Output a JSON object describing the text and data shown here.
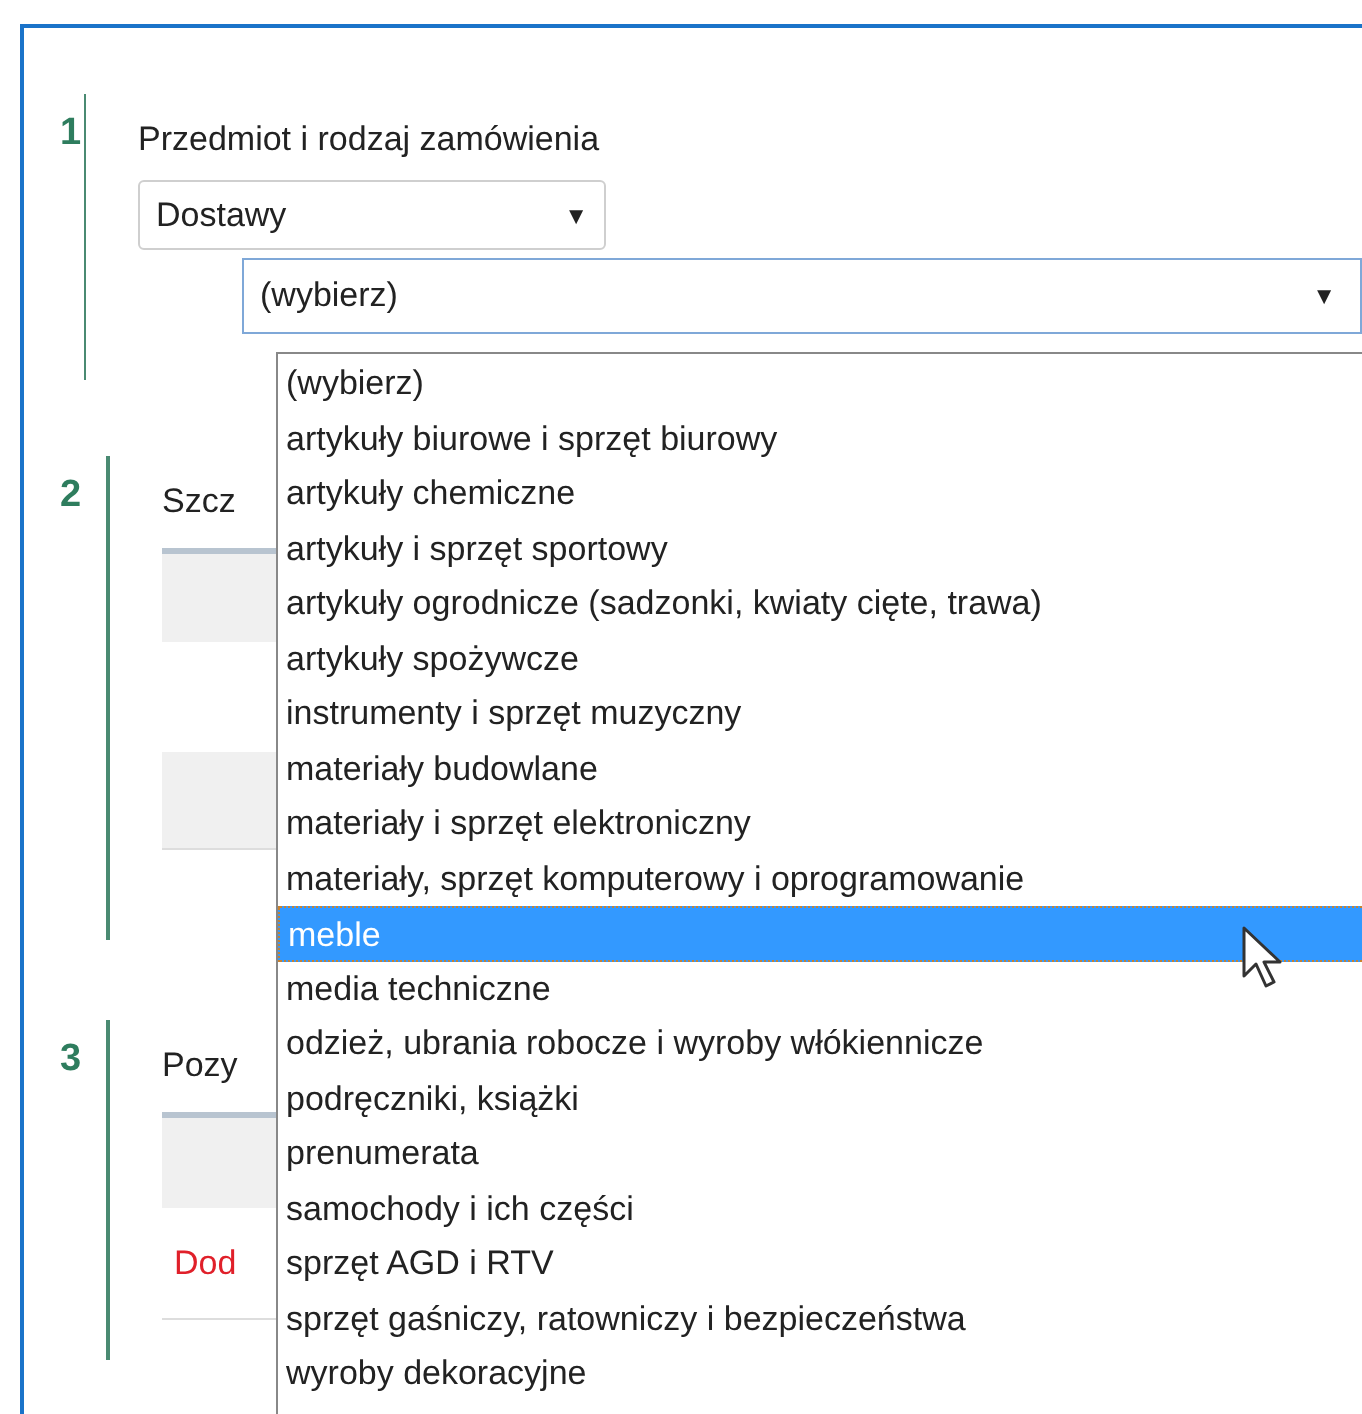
{
  "sections": [
    {
      "number": "1",
      "kind": "form",
      "title": "Przedmiot i rodzaj zamówienia",
      "order_type": {
        "value": "Dostawy",
        "arrow": "▼"
      },
      "category": {
        "value": "(wybierz)",
        "arrow": "▼",
        "expanded": true,
        "options": [
          {
            "label": "(wybierz)",
            "highlighted": false
          },
          {
            "label": "artykuły biurowe i sprzęt biurowy",
            "highlighted": false
          },
          {
            "label": "artykuły chemiczne",
            "highlighted": false
          },
          {
            "label": "artykuły i sprzęt sportowy",
            "highlighted": false
          },
          {
            "label": "artykuły ogrodnicze (sadzonki, kwiaty cięte, trawa)",
            "highlighted": false
          },
          {
            "label": "artykuły spożywcze",
            "highlighted": false
          },
          {
            "label": "instrumenty i sprzęt muzyczny",
            "highlighted": false
          },
          {
            "label": "materiały budowlane",
            "highlighted": false
          },
          {
            "label": "materiały i sprzęt elektroniczny",
            "highlighted": false
          },
          {
            "label": "materiały, sprzęt komputerowy i oprogramowanie",
            "highlighted": false
          },
          {
            "label": "meble",
            "highlighted": true
          },
          {
            "label": "media techniczne",
            "highlighted": false
          },
          {
            "label": "odzież, ubrania robocze i wyroby włókiennicze",
            "highlighted": false
          },
          {
            "label": "podręczniki, książki",
            "highlighted": false
          },
          {
            "label": "prenumerata",
            "highlighted": false
          },
          {
            "label": "samochody i ich części",
            "highlighted": false
          },
          {
            "label": "sprzęt AGD i RTV",
            "highlighted": false
          },
          {
            "label": "sprzęt gaśniczy, ratowniczy i bezpieczeństwa",
            "highlighted": false
          },
          {
            "label": "wyroby dekoracyjne",
            "highlighted": false
          }
        ]
      }
    },
    {
      "number": "2",
      "kind": "table",
      "title": "Szcz"
    },
    {
      "number": "3",
      "kind": "table",
      "title": "Pozy",
      "link": "Dod"
    }
  ]
}
